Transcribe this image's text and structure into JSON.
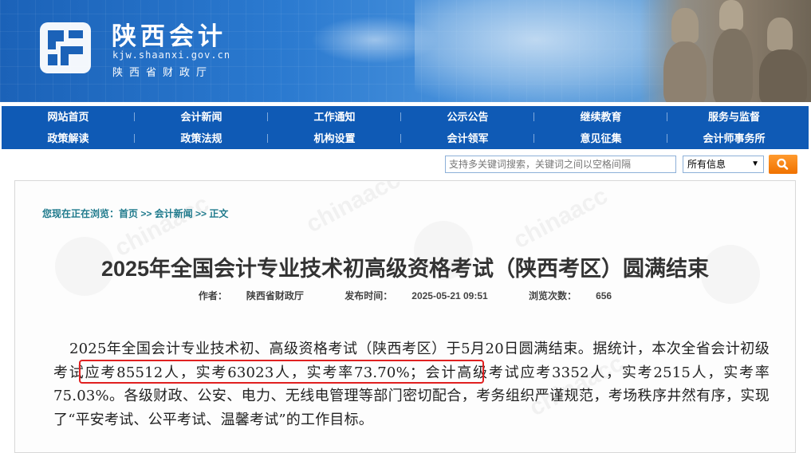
{
  "header": {
    "site_name": "陕西会计",
    "site_url": "kjw.shaanxi.gov.cn",
    "department": "陕西省财政厅",
    "logo_icon": "shaanxi-accounting-logo",
    "brand_color": "#1b62b8"
  },
  "nav": {
    "row1": [
      "网站首页",
      "会计新闻",
      "工作通知",
      "公示公告",
      "继续教育",
      "服务与监督"
    ],
    "row2": [
      "政策解读",
      "政策法规",
      "机构设置",
      "会计领军",
      "意见征集",
      "会计师事务所"
    ],
    "bar_color": "#0f5ab5"
  },
  "search": {
    "placeholder": "支持多关键词搜索，关键词之间以空格间隔",
    "scope_selected": "所有信息",
    "button_icon": "search-icon",
    "button_color": "#f07200"
  },
  "breadcrumb": {
    "prefix": "您现在正在浏览：",
    "path": "首页 >> 会计新闻 >> 正文"
  },
  "article": {
    "title": "2025年全国会计专业技术初高级资格考试（陕西考区）圆满结束",
    "author_label": "作者：",
    "author": "陕西省财政厅",
    "date_label": "发布时间：",
    "date": "2025-05-21 09:51",
    "views_label": "浏览次数：",
    "views": "656",
    "body_part1": "2025年全国会计专业技术初、高级资格考试（陕西考区）于5月20日圆满结束。据统计，本次全省会计",
    "body_highlight": "初级考试应考85512人，实考63023人，实考率73.70%；",
    "body_part2": "会计高级考试应考3352人，实考2515人，实考率75.03%。各级财政、公安、电力、无线电管理等部门密切配合，考务组织严谨规范，考场秩序井然有序，实现了“平安考试、公平考试、温馨考试”的工作目标。",
    "highlight_color": "#e02020"
  }
}
